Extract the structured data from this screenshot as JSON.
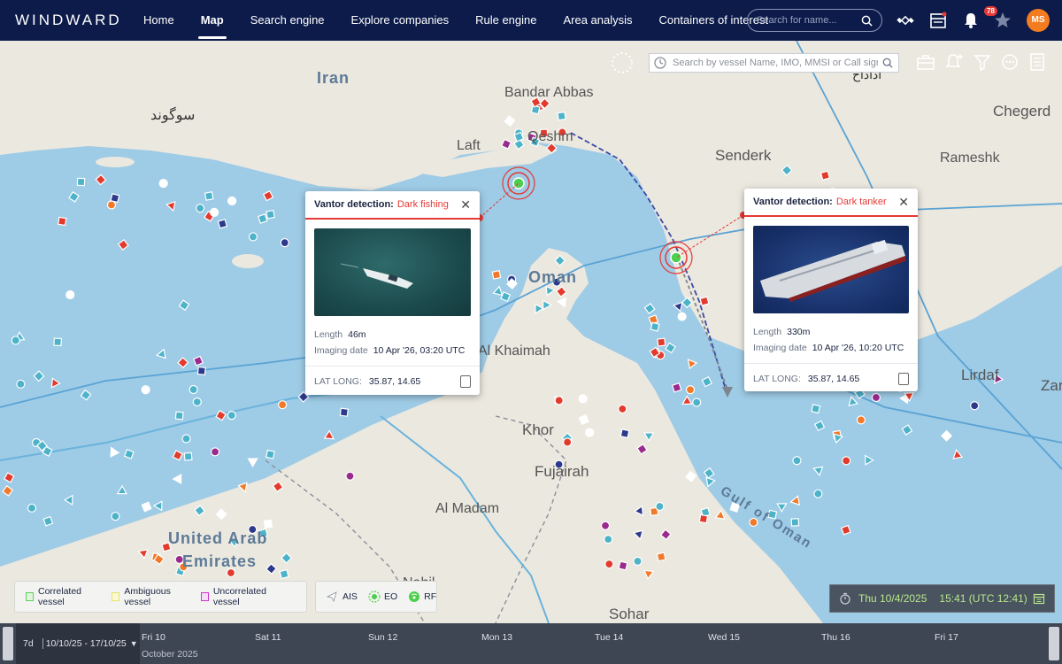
{
  "app": {
    "logo": "WINDWARD",
    "nav": [
      "Home",
      "Map",
      "Search engine",
      "Explore companies",
      "Rule engine",
      "Area analysis",
      "Containers of interest"
    ],
    "active_nav": "Map",
    "search_placeholder": "Search for name...",
    "notification_count": "78",
    "avatar_initials": "MS"
  },
  "map": {
    "search_placeholder": "Search by vessel Name, IMO, MMSI or Call sign",
    "labels": {
      "iran": "Iran",
      "bandar_abbas": "Bandar Abbas",
      "qeshm": "Qeshm",
      "laft": "Laft",
      "senderk": "Senderk",
      "rameshk": "Rameshk",
      "chegerd": "Chegerd",
      "oman": "Oman",
      "ras_al_khaimah": "Al Khaimah",
      "khor": "Khor",
      "fujairah": "Fujairah",
      "al_madam": "Al Madam",
      "uae_line1": "United Arab",
      "uae_line2": "Emirates",
      "nahil": "Nahil",
      "sohar": "Sohar",
      "lirdaf": "Lirdaf",
      "zar": "Zar",
      "gulf_of_oman": "Gulf of Oman",
      "persian_script_1": "ﺳﻮﮔﻮﻧﺪ",
      "persian_script_2": "ﺍﺩﺍﺩﺍﺡ"
    }
  },
  "popup_left": {
    "title_key": "Vantor detection:",
    "title_value": "Dark fishing",
    "length_label": "Length",
    "length_value": "46m",
    "date_label": "Imaging date",
    "date_value": "10 Apr '26, 03:20 UTC",
    "latlong_label": "LAT LONG:",
    "latlong_value": "35.87, 14.65"
  },
  "popup_right": {
    "title_key": "Vantor detection:",
    "title_value": "Dark tanker",
    "length_label": "Length",
    "length_value": "330m",
    "date_label": "Imaging date",
    "date_value": "10 Apr '26, 10:20 UTC",
    "latlong_label": "LAT LONG:",
    "latlong_value": "35.87, 14.65"
  },
  "legend": {
    "correlated": "Correlated vessel",
    "ambiguous": "Ambiguous vessel",
    "uncorrelated": "Uncorrelated vessel",
    "ais": "AIS",
    "eo": "EO",
    "rf": "RF",
    "colors": {
      "correlated": "#5ccf5c",
      "ambiguous": "#e6e36a",
      "uncorrelated": "#cc33cc"
    }
  },
  "datetime": {
    "date": "Thu 10/4/2025",
    "time": "15:41 (UTC 12:41)"
  },
  "timeline": {
    "range_days": "7d",
    "range_text": "10/10/25 - 17/10/25",
    "days": [
      "Fri 10",
      "Sat 11",
      "Sun 12",
      "Mon 13",
      "Tue 14",
      "Wed 15",
      "Thu 16",
      "Fri 17"
    ],
    "month": "October 2025"
  },
  "colors": {
    "nav_bg": "#0c1b4a",
    "sea": "#9ecbe6",
    "land": "#ebe8df",
    "vessel_red": "#e23b2e",
    "vessel_teal": "#4db3c9",
    "accent_red": "#e53935"
  }
}
